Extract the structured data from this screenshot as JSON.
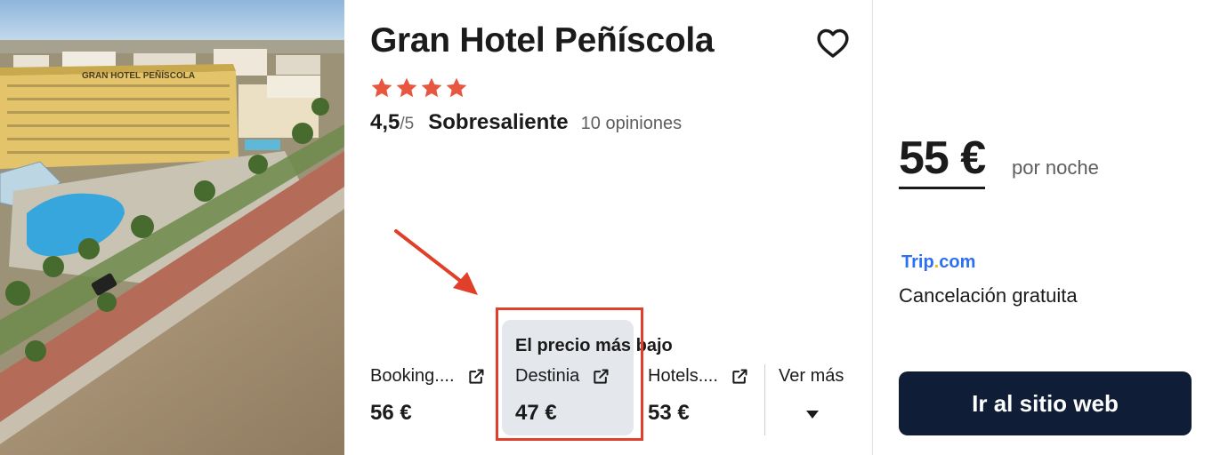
{
  "hotel": {
    "name": "Gran Hotel Peñíscola",
    "star_count": 4,
    "star_color": "#e8563f",
    "score": "4,5",
    "score_max": "/5",
    "verdict": "Sobresaliente",
    "reviews": "10 opiniones",
    "photo_sign": "GRAN HOTEL PEÑÍSCOLA"
  },
  "deal": {
    "label": "El precio más bajo",
    "highlight_color": "#e0402a"
  },
  "offers": [
    {
      "provider": "Booking....",
      "price": "56 €",
      "icon": "external-link-icon"
    },
    {
      "provider": "Destinia",
      "price": "47 €",
      "icon": "external-link-icon"
    },
    {
      "provider": "Hotels....",
      "price": "53 €",
      "icon": "external-link-icon"
    }
  ],
  "more": {
    "label": "Ver más",
    "icon": "caret-down-icon"
  },
  "summary": {
    "price": "55 €",
    "per_night": "por noche",
    "provider_logo_main": "Trip",
    "provider_logo_dot": ".",
    "provider_logo_tail": "com",
    "cancellation": "Cancelación gratuita",
    "cta": "Ir al sitio web"
  },
  "colors": {
    "brand_dark": "#0f1e36",
    "trip_blue": "#2b6ff5",
    "trip_dot": "#ffb900"
  }
}
